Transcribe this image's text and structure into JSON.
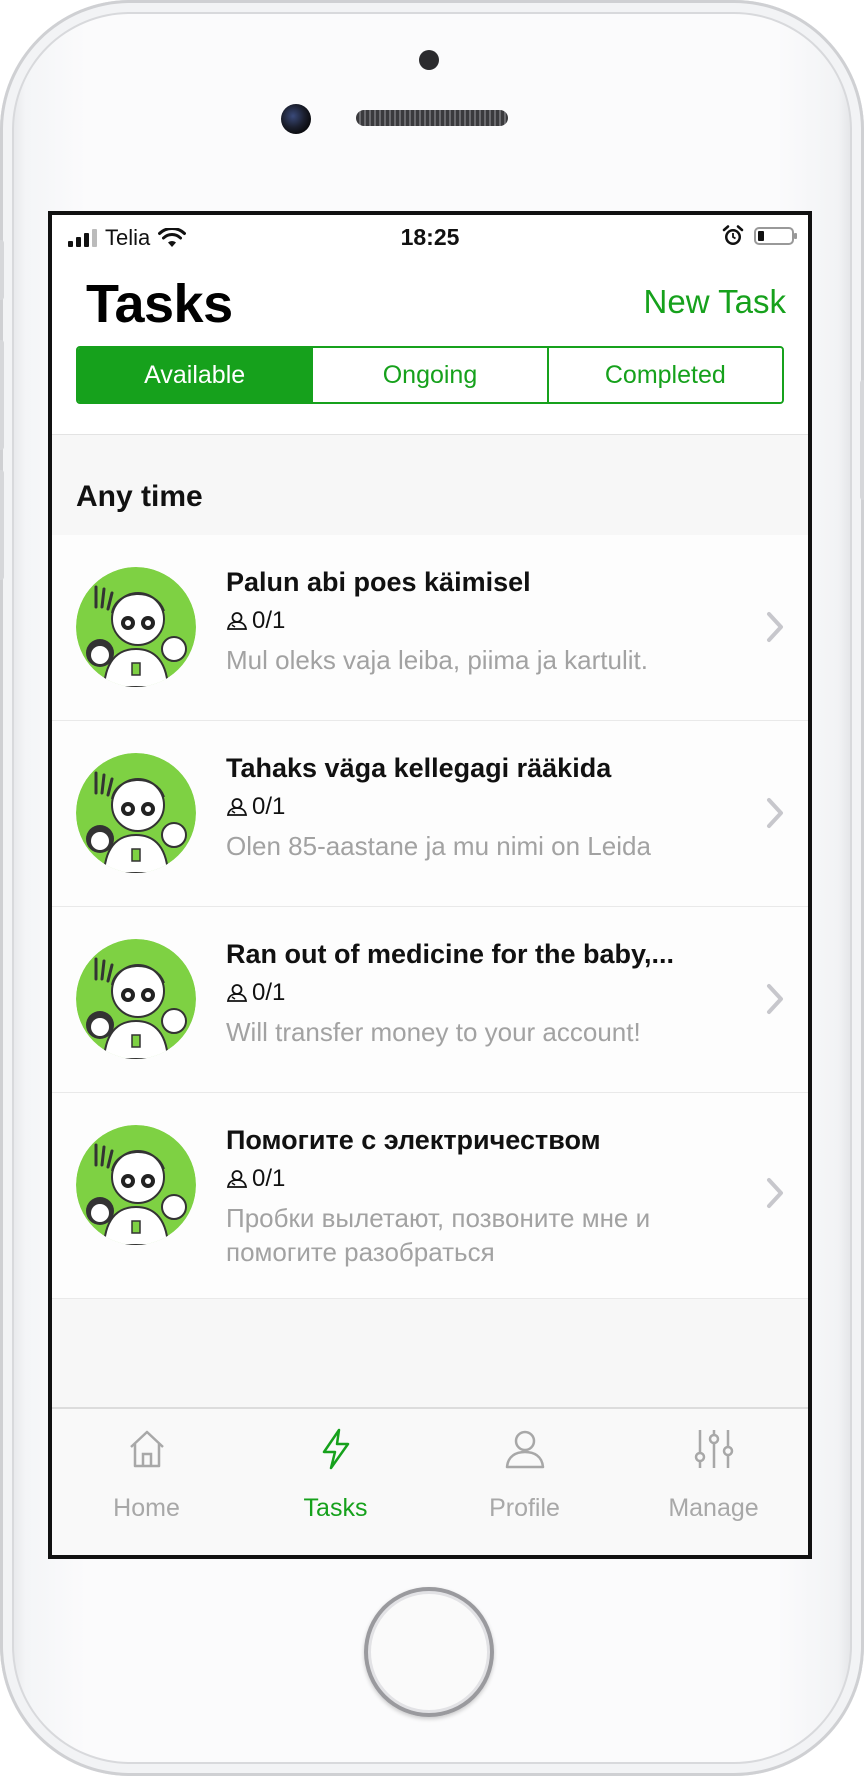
{
  "status_bar": {
    "carrier": "Telia",
    "time": "18:25"
  },
  "header": {
    "title": "Tasks",
    "new_task_label": "New Task"
  },
  "segments": [
    {
      "label": "Available",
      "active": true
    },
    {
      "label": "Ongoing",
      "active": false
    },
    {
      "label": "Completed",
      "active": false
    }
  ],
  "section": {
    "title": "Any time"
  },
  "tasks": [
    {
      "title": "Palun abi poes käimisel",
      "count": "0/1",
      "description": "Mul oleks vaja leiba, piima ja kartulit."
    },
    {
      "title": "Tahaks väga kellegagi rääkida",
      "count": "0/1",
      "description": "Olen 85-aastane ja mu nimi on Leida"
    },
    {
      "title": "Ran out of medicine for the baby,...",
      "count": "0/1",
      "description": "Will transfer money to your account!"
    },
    {
      "title": "Помогите с электричеством",
      "count": "0/1",
      "description": "Пробки вылетают, позвоните мне и помогите разобраться"
    }
  ],
  "tabbar": [
    {
      "label": "Home",
      "icon": "home-icon",
      "active": false
    },
    {
      "label": "Tasks",
      "icon": "lightning-icon",
      "active": true
    },
    {
      "label": "Profile",
      "icon": "profile-icon",
      "active": false
    },
    {
      "label": "Manage",
      "icon": "sliders-icon",
      "active": false
    }
  ],
  "colors": {
    "accent": "#16a11c",
    "avatar_bg": "#7ed143",
    "muted_text": "#a2a2a2"
  }
}
